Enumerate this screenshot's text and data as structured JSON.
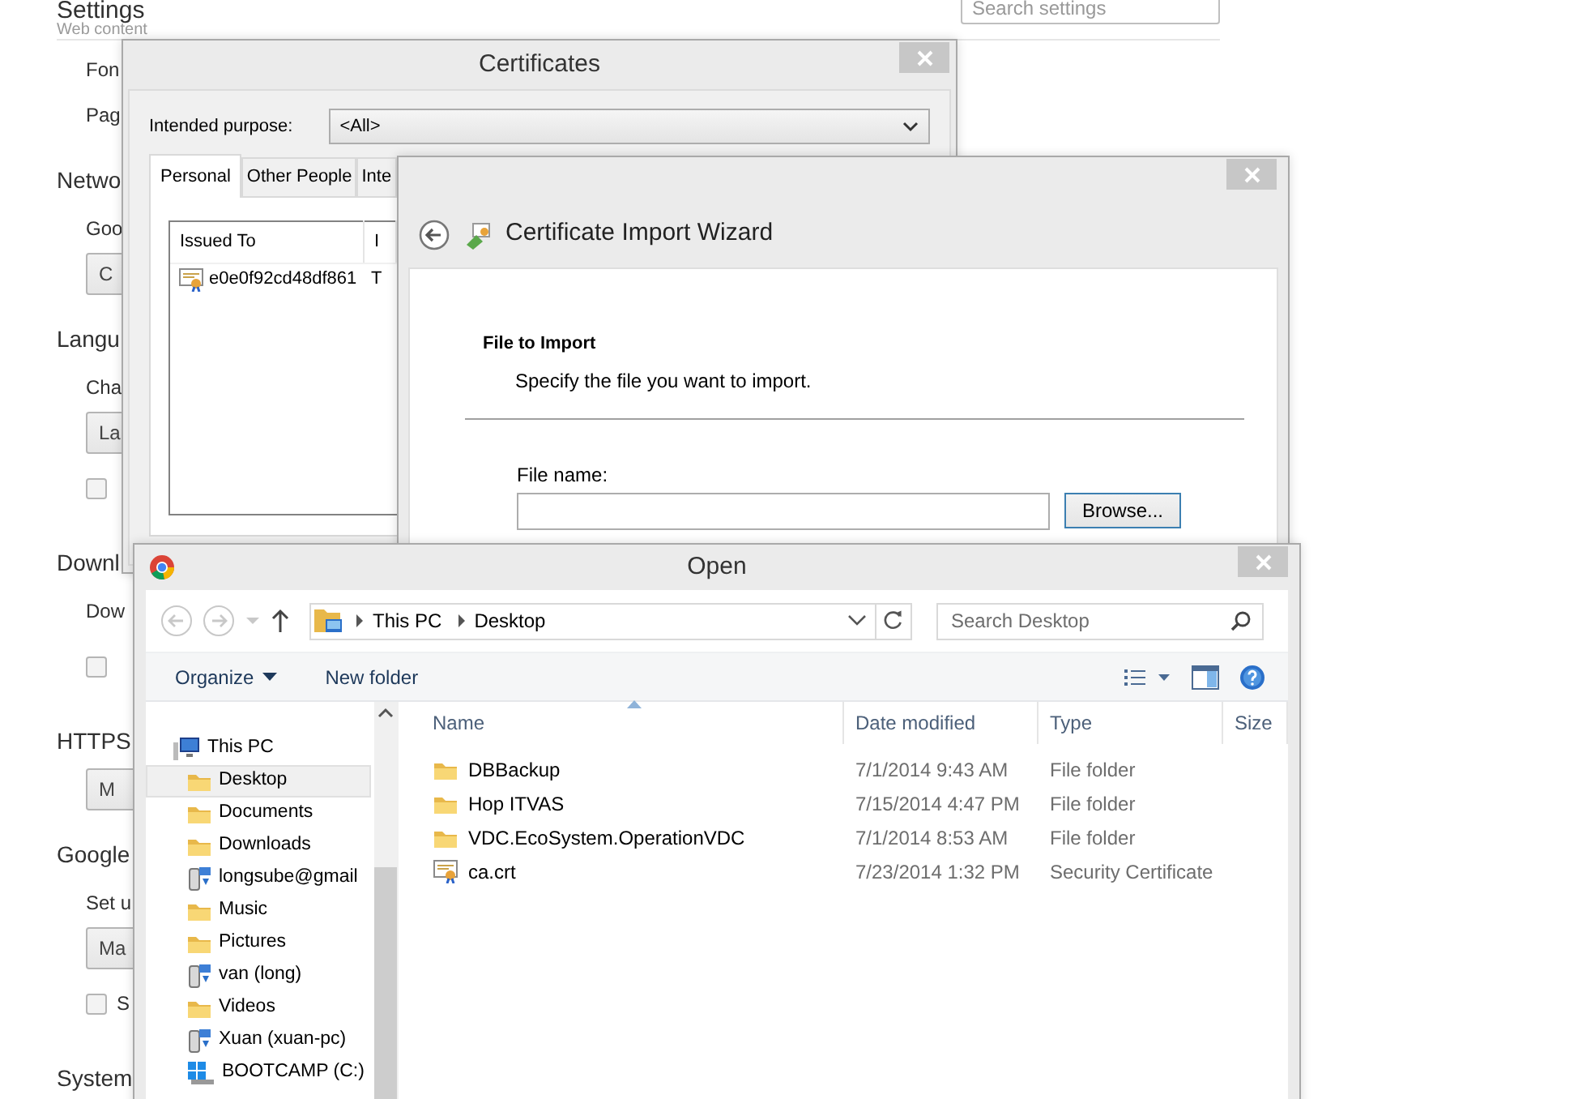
{
  "settings": {
    "title": "Settings",
    "subtitle": "Web content",
    "search": {
      "placeholder": "Search settings"
    },
    "items": [
      {
        "kind": "text",
        "text": "Fon"
      },
      {
        "kind": "text",
        "text": "Pag"
      },
      {
        "kind": "heading",
        "text": "Netwo"
      },
      {
        "kind": "text",
        "text": "Goo"
      },
      {
        "kind": "button",
        "text": "C"
      },
      {
        "kind": "heading",
        "text": "Langu"
      },
      {
        "kind": "text",
        "text": "Cha"
      },
      {
        "kind": "button",
        "text": "La"
      },
      {
        "kind": "checkbox",
        "checked": false
      },
      {
        "kind": "heading",
        "text": "Downl"
      },
      {
        "kind": "text",
        "text": "Dow"
      },
      {
        "kind": "checkbox",
        "checked": false
      },
      {
        "kind": "heading",
        "text": "HTTPS"
      },
      {
        "kind": "button",
        "text": "M"
      },
      {
        "kind": "heading",
        "text": "Google"
      },
      {
        "kind": "text",
        "text": "Set u"
      },
      {
        "kind": "button",
        "text": "Ma"
      },
      {
        "kind": "checkbox",
        "checked": false,
        "text": "S"
      },
      {
        "kind": "heading",
        "text": "System"
      }
    ]
  },
  "certificates_window": {
    "title": "Certificates",
    "purpose_label": "Intended purpose:",
    "purpose_value": "<All>",
    "tabs": [
      {
        "label": "Personal",
        "selected": true
      },
      {
        "label": "Other People",
        "selected": false
      },
      {
        "label": "Inte",
        "selected": false
      }
    ],
    "columns": [
      "Issued To",
      "I"
    ],
    "rows": [
      {
        "cells": [
          "e0e0f92cd48df861",
          "T"
        ]
      }
    ]
  },
  "wizard": {
    "title": "Certificate Import Wizard",
    "heading": "File to Import",
    "description": "Specify the file you want to import.",
    "file_label": "File name:",
    "browse": "Browse..."
  },
  "open_dialog": {
    "title": "Open",
    "path": [
      "This PC",
      "Desktop"
    ],
    "search": {
      "placeholder": "Search Desktop"
    },
    "commands": [
      {
        "label": "Organize",
        "dropdown": true
      },
      {
        "label": "New folder",
        "dropdown": false
      }
    ],
    "navigation": [
      {
        "label": "This PC",
        "kind": "computer",
        "selected": false,
        "children": [
          {
            "label": "Desktop",
            "kind": "folder",
            "selected": true
          },
          {
            "label": "Documents",
            "kind": "folder",
            "selected": false
          },
          {
            "label": "Downloads",
            "kind": "folder",
            "selected": false
          },
          {
            "label": "longsube@gmail",
            "kind": "network",
            "selected": false
          },
          {
            "label": "Music",
            "kind": "folder",
            "selected": false
          },
          {
            "label": "Pictures",
            "kind": "folder",
            "selected": false
          },
          {
            "label": "van (long)",
            "kind": "network",
            "selected": false
          },
          {
            "label": "Videos",
            "kind": "folder",
            "selected": false
          },
          {
            "label": "Xuan (xuan-pc)",
            "kind": "network",
            "selected": false
          },
          {
            "label": "BOOTCAMP (C:)",
            "kind": "drive",
            "selected": false
          }
        ]
      }
    ],
    "columns": [
      {
        "label": "Name",
        "sorted": true
      },
      {
        "label": "Date modified",
        "sorted": false
      },
      {
        "label": "Type",
        "sorted": false
      },
      {
        "label": "Size",
        "sorted": false
      }
    ],
    "files": [
      {
        "kind": "folder",
        "name": "DBBackup",
        "date": "7/1/2014 9:43 AM",
        "type": "File folder"
      },
      {
        "kind": "folder",
        "name": "Hop ITVAS",
        "date": "7/15/2014 4:47 PM",
        "type": "File folder"
      },
      {
        "kind": "folder",
        "name": "VDC.EcoSystem.OperationVDC",
        "date": "7/1/2014 8:53 AM",
        "type": "File folder"
      },
      {
        "kind": "certificate",
        "name": "ca.crt",
        "date": "7/23/2014 1:32 PM",
        "type": "Security Certificate"
      }
    ]
  }
}
